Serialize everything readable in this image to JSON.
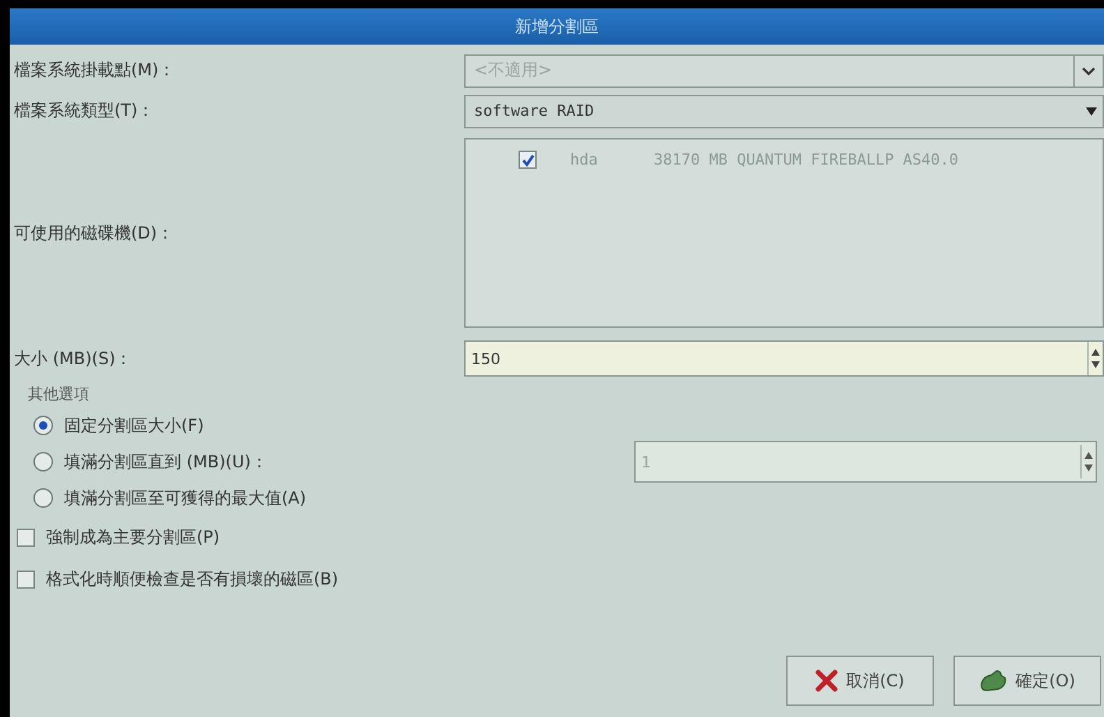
{
  "window": {
    "title": "新增分割區"
  },
  "mount_point": {
    "label": "檔案系統掛載點(M)：",
    "value": "<不適用>",
    "disabled": true
  },
  "fs_type": {
    "label": "檔案系統類型(T)：",
    "value": "software RAID"
  },
  "drives": {
    "label": "可使用的磁碟機(D)：",
    "rows": [
      {
        "checked": true,
        "device": "hda",
        "description": "38170 MB QUANTUM FIREBALLP AS40.0"
      }
    ]
  },
  "size": {
    "label": "大小 (MB)(S)：",
    "value": "150"
  },
  "other_options": {
    "title": "其他選項",
    "radios": [
      {
        "label": "固定分割區大小(F)",
        "selected": true
      },
      {
        "label": "填滿分割區直到 (MB)(U)：",
        "selected": false,
        "field": {
          "value": "1",
          "disabled": true
        }
      },
      {
        "label": "填滿分割區至可獲得的最大值(A)",
        "selected": false
      }
    ]
  },
  "checkboxes": [
    {
      "label": "強制成為主要分割區(P)",
      "checked": false
    },
    {
      "label": "格式化時順便檢查是否有損壞的磁區(B)",
      "checked": false
    }
  ],
  "buttons": [
    {
      "kind": "cancel",
      "label": "取消(C)"
    },
    {
      "kind": "ok",
      "label": "確定(O)"
    }
  ]
}
